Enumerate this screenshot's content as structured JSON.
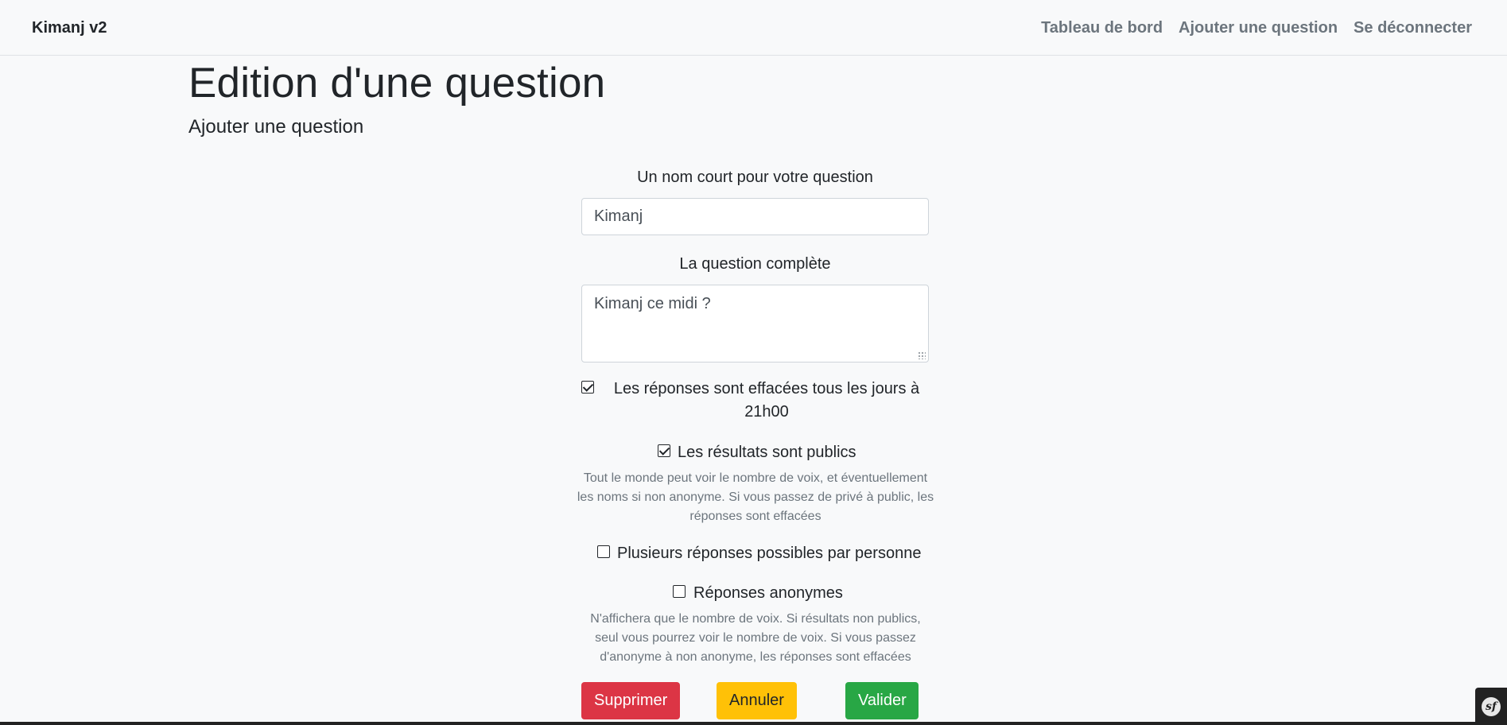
{
  "navbar": {
    "brand": "Kimanj v2",
    "links": [
      "Tableau de bord",
      "Ajouter une question",
      "Se déconnecter"
    ]
  },
  "page": {
    "title": "Edition d'une question",
    "subtitle": "Ajouter une question"
  },
  "form": {
    "short_name_label": "Un nom court pour votre question",
    "short_name_value": "Kimanj",
    "full_question_label": "La question complète",
    "full_question_value": "Kimanj ce midi ?",
    "options": {
      "daily_reset": {
        "label_line1": "Les réponses sont effacées tous les jours à",
        "label_line2": "21h00",
        "checked": true
      },
      "public_results": {
        "label": "Les résultats sont publics",
        "checked": true,
        "help": [
          "Tout le monde peut voir le nombre de voix, et éventuellement",
          "les noms si non anonyme. Si vous passez de privé à public, les",
          "réponses sont effacées"
        ]
      },
      "multiple_answers": {
        "label": "Plusieurs réponses possibles par personne",
        "checked": false
      },
      "anonymous": {
        "label": "Réponses anonymes",
        "checked": false,
        "help": [
          "N'affichera que le nombre de voix. Si résultats non publics,",
          "seul vous pourrez voir le nombre de voix. Si vous passez",
          "d'anonyme à non anonyme, les réponses sont effacées"
        ]
      }
    },
    "buttons": {
      "delete": "Supprimer",
      "cancel": "Annuler",
      "submit": "Valider"
    }
  },
  "debug_toolbar": {
    "logo": "sf"
  },
  "colors": {
    "danger": "#dc3545",
    "warning": "#ffc107",
    "success": "#28a745",
    "muted": "#6c757d"
  }
}
